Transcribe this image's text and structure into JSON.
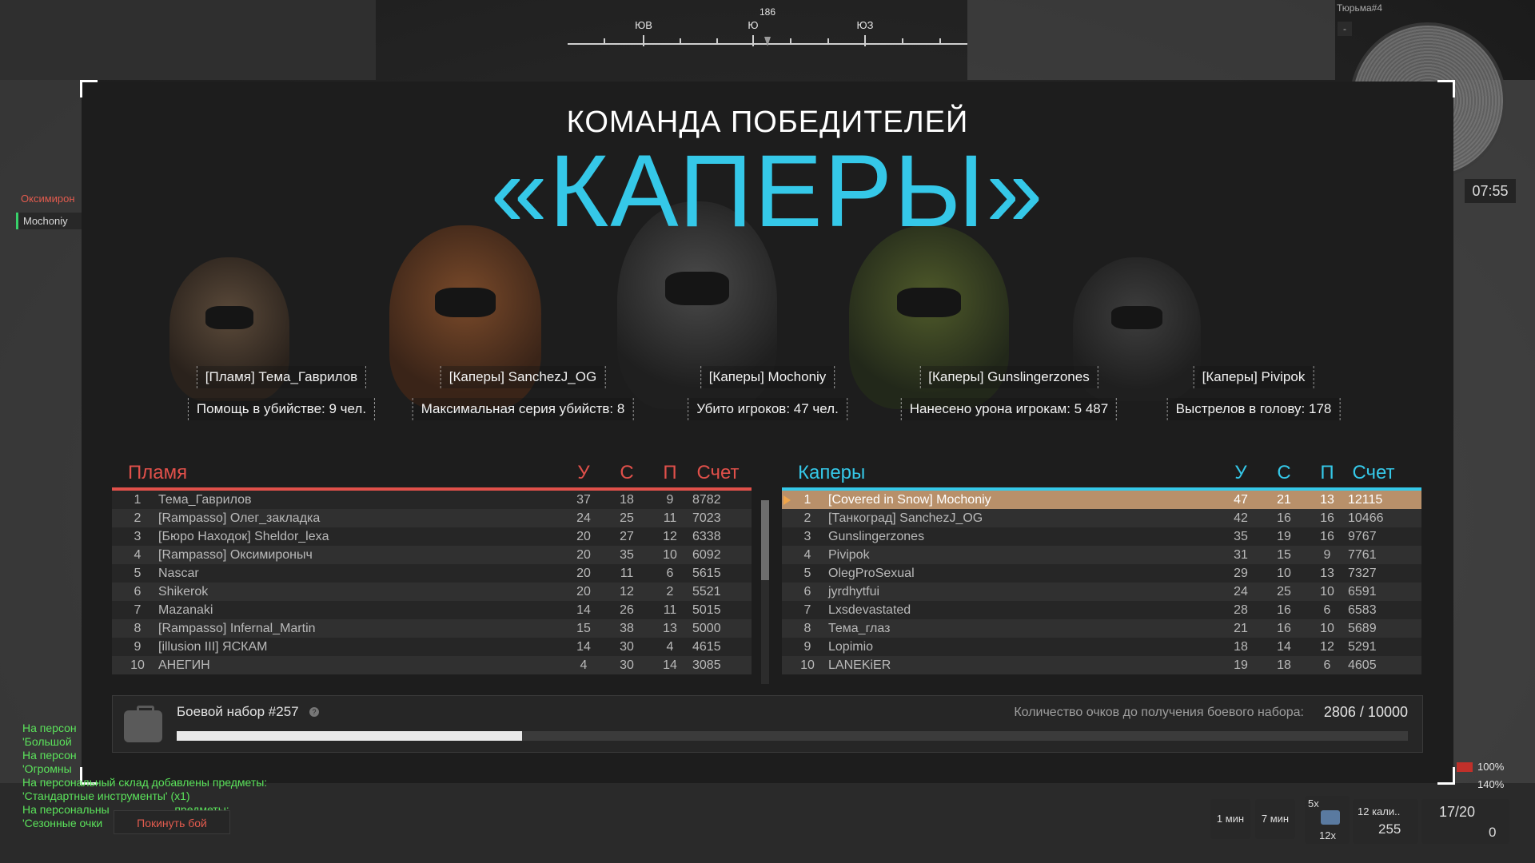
{
  "compass": {
    "heading": "186",
    "directions": [
      {
        "label": "ЮВ",
        "pos": 95
      },
      {
        "label": "Ю",
        "pos": 232
      },
      {
        "label": "ЮЗ",
        "pos": 372
      }
    ]
  },
  "minimap": {
    "title": "Тюрьма#4",
    "btn": "-",
    "timer": "07:55"
  },
  "side": {
    "red_name": "Оксимирон",
    "green_name": "Mochoniy"
  },
  "header": {
    "subtitle": "КОМАНДА ПОБЕДИТЕЛЕЙ",
    "team": "«КАПЕРЫ»"
  },
  "awards": [
    {
      "name": "[Пламя] Тема_Гаврилов",
      "stat": "Помощь в убийстве: 9 чел."
    },
    {
      "name": "[Каперы] SanchezJ_OG",
      "stat": "Максимальная серия убийств: 8"
    },
    {
      "name": "[Каперы] Mochoniy",
      "stat": "Убито игроков: 47 чел."
    },
    {
      "name": "[Каперы] Gunslingerzones",
      "stat": "Нанесено урона игрокам: 5 487"
    },
    {
      "name": "[Каперы] Pivipok",
      "stat": "Выстрелов в голову: 178"
    }
  ],
  "columns": {
    "kills": "У",
    "deaths": "С",
    "assists": "П",
    "score": "Счет"
  },
  "teams": {
    "left": {
      "name": "Пламя",
      "color": "#e0504a",
      "rows": [
        {
          "rank": "1",
          "name": "Тема_Гаврилов",
          "k": "37",
          "d": "18",
          "a": "9",
          "score": "8782"
        },
        {
          "rank": "2",
          "name": "[Rampasso] Олег_закладка",
          "k": "24",
          "d": "25",
          "a": "11",
          "score": "7023"
        },
        {
          "rank": "3",
          "name": "[Бюро Находок] Sheldor_lexa",
          "k": "20",
          "d": "27",
          "a": "12",
          "score": "6338"
        },
        {
          "rank": "4",
          "name": "[Rampasso] Оксимироныч",
          "k": "20",
          "d": "35",
          "a": "10",
          "score": "6092"
        },
        {
          "rank": "5",
          "name": "Nascar",
          "k": "20",
          "d": "11",
          "a": "6",
          "score": "5615"
        },
        {
          "rank": "6",
          "name": "Shikerok",
          "k": "20",
          "d": "12",
          "a": "2",
          "score": "5521"
        },
        {
          "rank": "7",
          "name": "Mazanaki",
          "k": "14",
          "d": "26",
          "a": "11",
          "score": "5015"
        },
        {
          "rank": "8",
          "name": "[Rampasso] Infernal_Martin",
          "k": "15",
          "d": "38",
          "a": "13",
          "score": "5000"
        },
        {
          "rank": "9",
          "name": "[illusion III] ЯСКАМ",
          "k": "14",
          "d": "30",
          "a": "4",
          "score": "4615"
        },
        {
          "rank": "10",
          "name": "АНЕГИН",
          "k": "4",
          "d": "30",
          "a": "14",
          "score": "3085"
        }
      ]
    },
    "right": {
      "name": "Каперы",
      "color": "#35c8e8",
      "rows": [
        {
          "rank": "1",
          "name": "[Covered in Snow] Mochoniy",
          "k": "47",
          "d": "21",
          "a": "13",
          "score": "12115",
          "me": true
        },
        {
          "rank": "2",
          "name": "[Танкоград] SanchezJ_OG",
          "k": "42",
          "d": "16",
          "a": "16",
          "score": "10466"
        },
        {
          "rank": "3",
          "name": "Gunslingerzones",
          "k": "35",
          "d": "19",
          "a": "16",
          "score": "9767"
        },
        {
          "rank": "4",
          "name": "Pivipok",
          "k": "31",
          "d": "15",
          "a": "9",
          "score": "7761"
        },
        {
          "rank": "5",
          "name": "OlegProSexual",
          "k": "29",
          "d": "10",
          "a": "13",
          "score": "7327"
        },
        {
          "rank": "6",
          "name": "jyrdhytfui",
          "k": "24",
          "d": "25",
          "a": "10",
          "score": "6591"
        },
        {
          "rank": "7",
          "name": "Lxsdevastated",
          "k": "28",
          "d": "16",
          "a": "6",
          "score": "6583"
        },
        {
          "rank": "8",
          "name": "Тема_глаз",
          "k": "21",
          "d": "16",
          "a": "10",
          "score": "5689"
        },
        {
          "rank": "9",
          "name": "Lopimio",
          "k": "18",
          "d": "14",
          "a": "12",
          "score": "5291"
        },
        {
          "rank": "10",
          "name": "LANEKiER",
          "k": "19",
          "d": "18",
          "a": "6",
          "score": "4605"
        }
      ]
    }
  },
  "battle_kit": {
    "title": "Боевой набор #257",
    "label": "Количество очков до получения боевого набора:",
    "value": "2806 / 10000",
    "progress": 0.2806
  },
  "chat": [
    "На персон",
    "'Большой",
    "На персон",
    "'Огромны",
    "На персональный склад добавлены предметы:",
    "'Стандартные инструменты' (x1)",
    "На персональны                     предметы:",
    "'Сезонные очки"
  ],
  "leave_button": "Покинуть бой",
  "hud": {
    "timer1": "1 мин",
    "timer2": "7 мин",
    "item_count": "5x",
    "item_sub": "12x",
    "ammo_type": "12 кали..",
    "ammo_reserve": "255",
    "mag": "17/20",
    "grenades": "0",
    "hp": "100%",
    "armor": "140%"
  },
  "colors": {
    "accent": "#35c8e8",
    "enemy": "#e0504a",
    "highlight": "#b8906a"
  }
}
